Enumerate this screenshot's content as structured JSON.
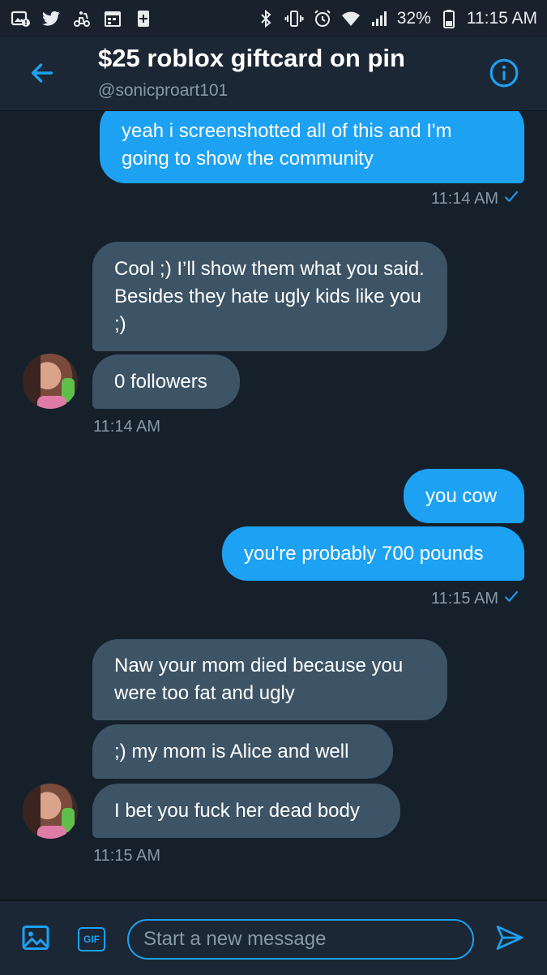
{
  "status_bar": {
    "battery": "32%",
    "time": "11:15 AM",
    "left_icons": [
      "gallery-alert-icon",
      "twitter-icon",
      "delivery-icon",
      "calendar-icon",
      "plus-box-icon"
    ],
    "right_icons": [
      "bluetooth-icon",
      "vibrate-icon",
      "alarm-icon",
      "wifi-icon",
      "signal-icon",
      "battery-icon"
    ]
  },
  "header": {
    "title": "$25 roblox giftcard on pin",
    "handle": "@sonicproart101"
  },
  "messages": [
    {
      "direction": "out",
      "text": "yeah i screenshotted all of this and I'm going to show the community"
    },
    {
      "direction": "meta_out",
      "text": "11:14 AM"
    },
    {
      "direction": "in",
      "text": "Cool ;) I’ll show them what you said. Besides they hate ugly kids like you ;)"
    },
    {
      "direction": "in",
      "text": "0 followers"
    },
    {
      "direction": "meta_in",
      "text": "11:14 AM"
    },
    {
      "direction": "out",
      "text": "you cow"
    },
    {
      "direction": "out",
      "text": "you're probably 700 pounds"
    },
    {
      "direction": "meta_out",
      "text": "11:15 AM"
    },
    {
      "direction": "in",
      "text": "Naw your mom died because you were too fat and ugly"
    },
    {
      "direction": "in",
      "text": ";) my mom is Alice and well"
    },
    {
      "direction": "in",
      "text": "I bet you fuck her dead body"
    },
    {
      "direction": "meta_in",
      "text": "11:15 AM"
    }
  ],
  "composer": {
    "placeholder": "Start a new message",
    "gif_label": "GIF"
  },
  "colors": {
    "accent": "#1da1f2",
    "incoming_bubble": "#3d5466",
    "background": "#15202b",
    "muted_text": "#8899a6"
  }
}
